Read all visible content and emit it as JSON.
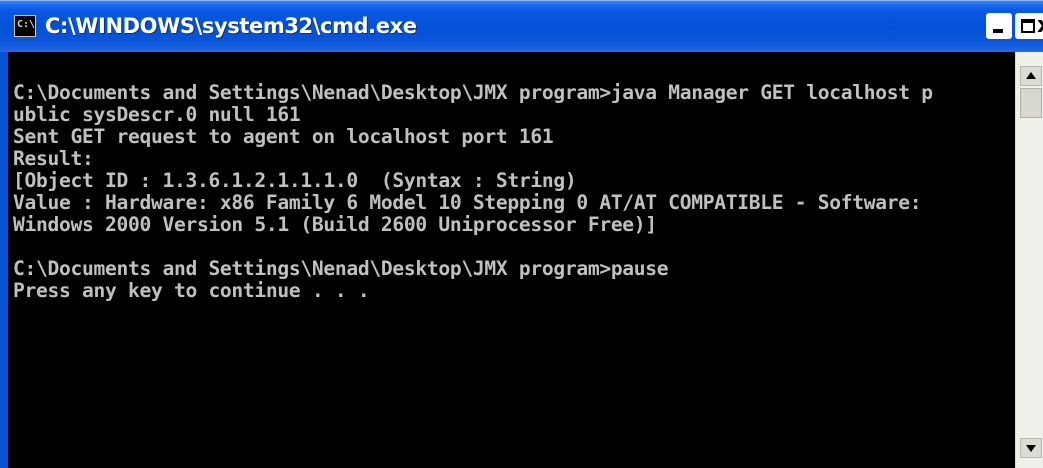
{
  "window": {
    "title": "C:\\WINDOWS\\system32\\cmd.exe",
    "icon_label": "C:\\",
    "icon": "cmd-icon",
    "buttons": {
      "minimize": "minimize-icon",
      "maximize": "maximize-icon",
      "close": "close-icon",
      "close_glyph": "x"
    },
    "colors": {
      "titlebar": "#0351d8",
      "console_background": "#000000",
      "console_text": "#c0c0c0"
    }
  },
  "console": {
    "lines": [
      "C:\\Documents and Settings\\Nenad\\Desktop\\JMX program>java Manager GET localhost p",
      "ublic sysDescr.0 null 161",
      "Sent GET request to agent on localhost port 161",
      "Result:",
      "[Object ID : 1.3.6.1.2.1.1.1.0  (Syntax : String)",
      "Value : Hardware: x86 Family 6 Model 10 Stepping 0 AT/AT COMPATIBLE - Software:",
      "Windows 2000 Version 5.1 (Build 2600 Uniprocessor Free)]",
      "",
      "C:\\Documents and Settings\\Nenad\\Desktop\\JMX program>pause",
      "Press any key to continue . . ."
    ]
  },
  "scrollbar": {
    "up_icon": "scroll-up-arrow-icon",
    "down_icon": "scroll-down-arrow-icon"
  }
}
